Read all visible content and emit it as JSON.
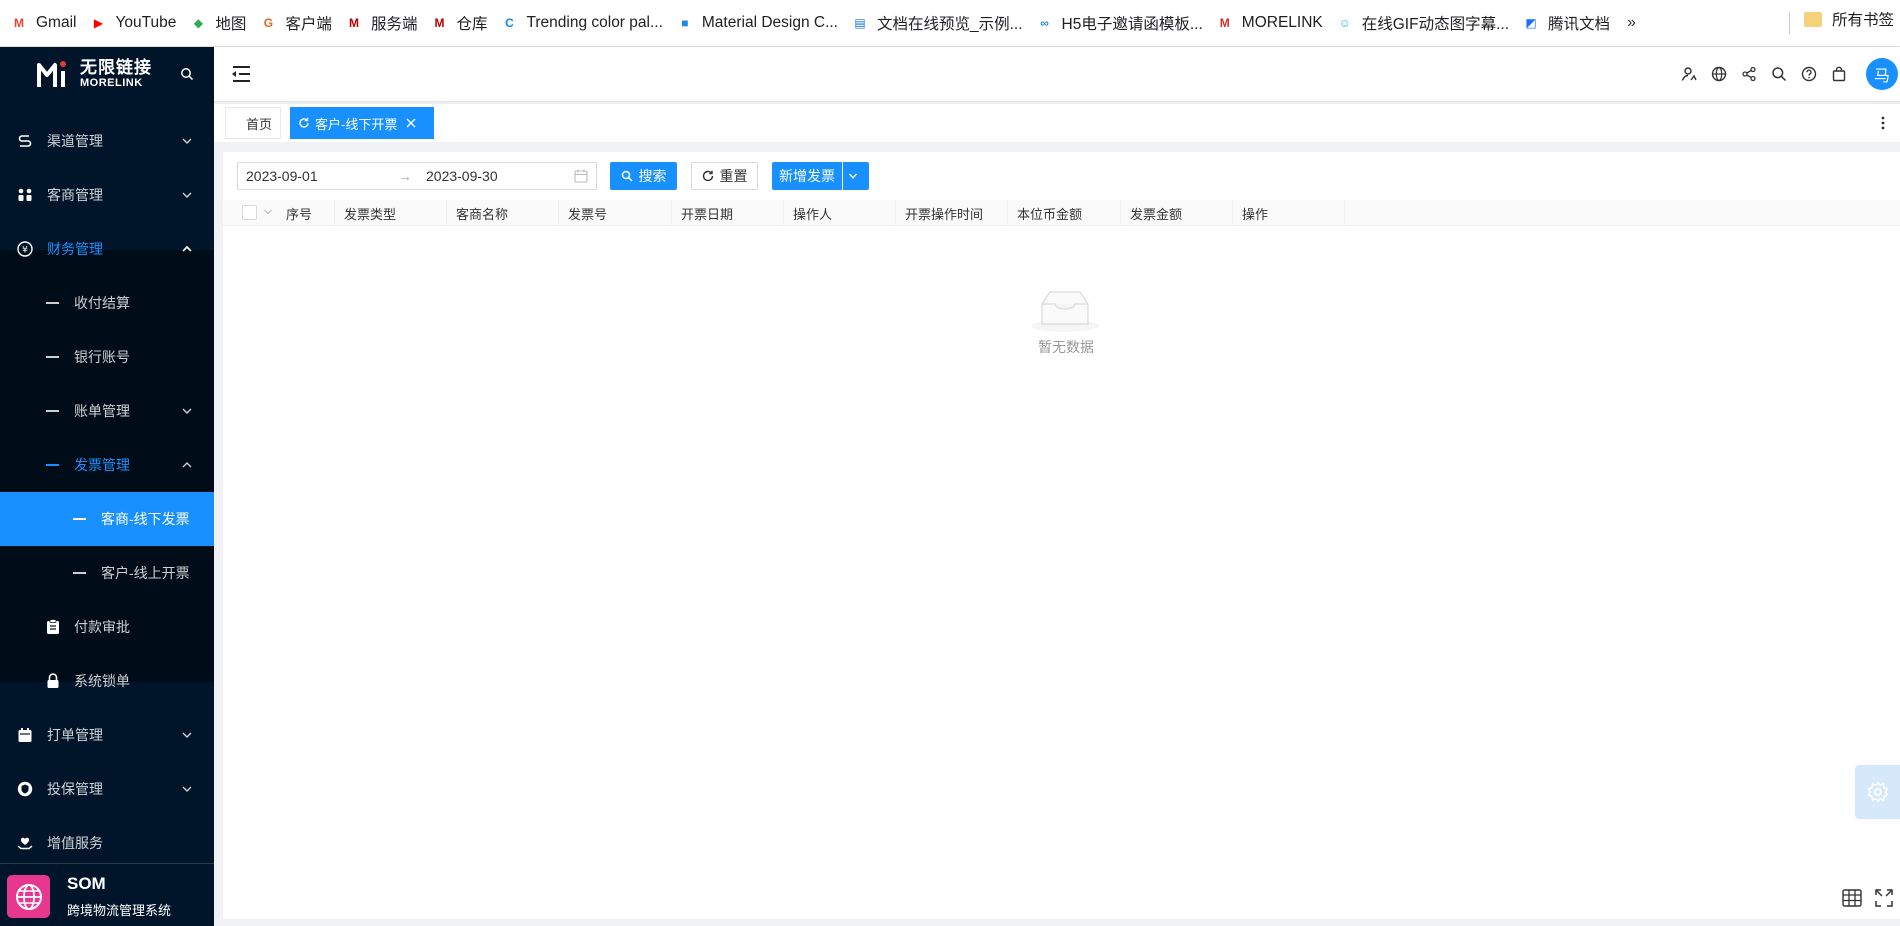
{
  "bookmarks": {
    "items": [
      {
        "label": "Gmail",
        "icon": "gmail-icon",
        "color": "#ea4335",
        "glyph": "M"
      },
      {
        "label": "YouTube",
        "icon": "youtube-icon",
        "color": "#ff0000",
        "glyph": "▶"
      },
      {
        "label": "地图",
        "icon": "map-icon",
        "color": "#34a853",
        "glyph": "◆"
      },
      {
        "label": "客户端",
        "icon": "client-icon",
        "color": "#e06b1f",
        "glyph": "G"
      },
      {
        "label": "服务端",
        "icon": "morelink-icon",
        "color": "#c00000",
        "glyph": "M"
      },
      {
        "label": "仓库",
        "icon": "morelink-icon",
        "color": "#c00000",
        "glyph": "M"
      },
      {
        "label": "Trending color pal...",
        "icon": "coolors-icon",
        "color": "#0a84ff",
        "glyph": "C"
      },
      {
        "label": "Material Design C...",
        "icon": "material-icon",
        "color": "#1e88e5",
        "glyph": "■"
      },
      {
        "label": "文档在线预览_示例...",
        "icon": "doc-icon",
        "color": "#1a73e8",
        "glyph": "▤"
      },
      {
        "label": "H5电子邀请函模板...",
        "icon": "h5-icon",
        "color": "#1e88e5",
        "glyph": "∞"
      },
      {
        "label": "MORELINK",
        "icon": "morelink-icon",
        "color": "#d32f2f",
        "glyph": "M"
      },
      {
        "label": "在线GIF动态图字幕...",
        "icon": "gif-icon",
        "color": "#29b6f6",
        "glyph": "☺"
      },
      {
        "label": "腾讯文档",
        "icon": "tencent-doc-icon",
        "color": "#1e6fff",
        "glyph": "◩"
      }
    ],
    "more": "»",
    "folder": "所有书签"
  },
  "sidebar": {
    "logo_cn": "无限链接",
    "logo_en": "MORELINK",
    "menu": [
      {
        "label": "渠道管理"
      },
      {
        "label": "客商管理"
      },
      {
        "label": "财务管理"
      },
      {
        "label": "收付结算"
      },
      {
        "label": "银行账号"
      },
      {
        "label": "账单管理"
      },
      {
        "label": "发票管理"
      },
      {
        "label": "客商-线下发票"
      },
      {
        "label": "客户-线上开票"
      },
      {
        "label": "付款审批"
      },
      {
        "label": "系统锁单"
      },
      {
        "label": "打单管理"
      },
      {
        "label": "投保管理"
      },
      {
        "label": "增值服务"
      }
    ],
    "bottom_title": "SOM",
    "bottom_subtitle": "跨境物流管理系统"
  },
  "header": {
    "avatar_text": "马"
  },
  "tabs": {
    "home": "首页",
    "active": "客户-线下开票"
  },
  "filters": {
    "start_date": "2023-09-01",
    "range_sep": "→",
    "end_date": "2023-09-30",
    "search_label": "搜索",
    "reset_label": "重置",
    "add_label": "新增发票"
  },
  "table": {
    "columns": [
      "序号",
      "发票类型",
      "客商名称",
      "发票号",
      "开票日期",
      "操作人",
      "开票操作时间",
      "本位币金额",
      "发票金额",
      "操作"
    ],
    "rows": [],
    "empty_text": "暂无数据"
  },
  "colors": {
    "primary": "#1890ff",
    "sidebar_bg": "#001529",
    "som_icon": "#e8378e"
  }
}
